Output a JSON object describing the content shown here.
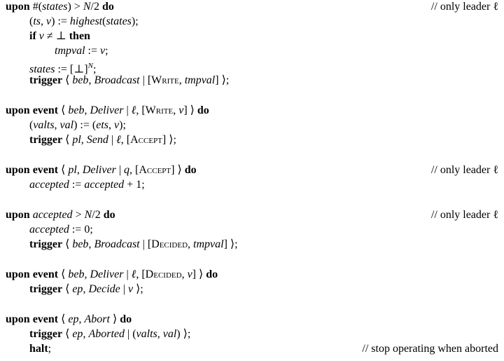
{
  "blocks": [
    {
      "lines": [
        {
          "text": "upon #(states) > N/2 do",
          "comment": "// only leader ℓ"
        },
        {
          "text": "(ts, v) := highest(states);"
        },
        {
          "text": "if v ≠ ⊥ then"
        },
        {
          "text": "tmpval := v;"
        },
        {
          "text": "states := [⊥]^N;"
        },
        {
          "text": "trigger ⟨ beb, Broadcast | [Write, tmpval] ⟩;"
        }
      ]
    },
    {
      "lines": [
        {
          "text": "upon event ⟨ beb, Deliver | ℓ, [Write, v] ⟩ do"
        },
        {
          "text": "(valts, val) := (ets, v);"
        },
        {
          "text": "trigger ⟨ pl, Send | ℓ, [Accept] ⟩;"
        }
      ]
    },
    {
      "lines": [
        {
          "text": "upon event ⟨ pl, Deliver | q, [Accept] ⟩ do",
          "comment": "// only leader ℓ"
        },
        {
          "text": "accepted := accepted + 1;"
        }
      ]
    },
    {
      "lines": [
        {
          "text": "upon accepted > N/2 do",
          "comment": "// only leader ℓ"
        },
        {
          "text": "accepted := 0;"
        },
        {
          "text": "trigger ⟨ beb, Broadcast | [Decided, tmpval] ⟩;"
        }
      ]
    },
    {
      "lines": [
        {
          "text": "upon event ⟨ beb, Deliver | ℓ, [Decided, v] ⟩ do"
        },
        {
          "text": "trigger ⟨ ep, Decide | v ⟩;"
        }
      ]
    },
    {
      "lines": [
        {
          "text": "upon event ⟨ ep, Abort ⟩ do"
        },
        {
          "text": "trigger ⟨ ep, Aborted | (valts, val) ⟩;"
        },
        {
          "text": "halt;",
          "comment": "// stop operating when aborted"
        }
      ]
    }
  ]
}
